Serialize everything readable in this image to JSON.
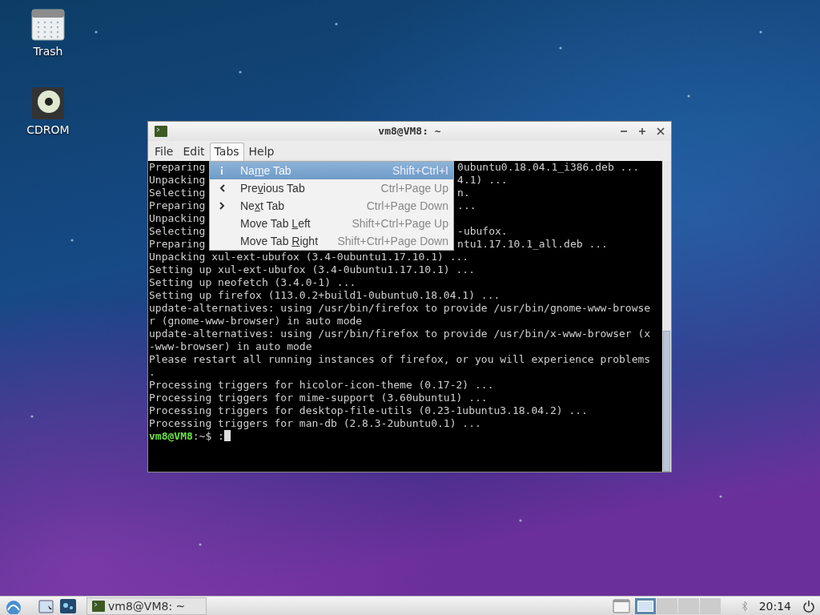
{
  "desktop_icons": [
    {
      "kind": "trash",
      "label": "Trash"
    },
    {
      "kind": "disc",
      "label": "CDROM"
    }
  ],
  "window": {
    "title": "vm8@VM8: ~",
    "menubar": [
      {
        "label": "File",
        "selected": false
      },
      {
        "label": "Edit",
        "selected": false
      },
      {
        "label": "Tabs",
        "selected": true
      },
      {
        "label": "Help",
        "selected": false
      }
    ],
    "tabs_menu": [
      {
        "kind": "info",
        "label_pre": "Na",
        "mnemonic": "m",
        "label_post": "e Tab",
        "shortcut": "Shift+Ctrl+I",
        "selected": true
      },
      {
        "kind": "prev",
        "label_pre": "Pre",
        "mnemonic": "v",
        "label_post": "ious Tab",
        "shortcut": "Ctrl+Page Up",
        "selected": false
      },
      {
        "kind": "next",
        "label_pre": "Ne",
        "mnemonic": "x",
        "label_post": "t Tab",
        "shortcut": "Ctrl+Page Down",
        "selected": false
      },
      {
        "kind": "plain",
        "label_pre": "Move Tab ",
        "mnemonic": "L",
        "label_post": "eft",
        "shortcut": "Shift+Ctrl+Page Up",
        "selected": false
      },
      {
        "kind": "plain",
        "label_pre": "Move Tab ",
        "mnemonic": "R",
        "label_post": "ight",
        "shortcut": "Shift+Ctrl+Page Down",
        "selected": false
      }
    ],
    "terminal_lines": [
      {
        "text": "Preparing",
        "tail": "0ubuntu0.18.04.1_i386.deb ..."
      },
      {
        "text": "Unpacking",
        "tail": "4.1) ..."
      },
      {
        "text": "Selecting",
        "tail": "n."
      },
      {
        "text": "Preparing",
        "tail": "..."
      },
      {
        "text": "Unpacking"
      },
      {
        "text": "Selecting",
        "tail": "-ubufox."
      },
      {
        "text": "Preparing",
        "tail": "ntu1.17.10.1_all.deb ..."
      },
      {
        "text": "Unpacking xul-ext-ubufox (3.4-0ubuntu1.17.10.1) ..."
      },
      {
        "text": "Setting up xul-ext-ubufox (3.4-0ubuntu1.17.10.1) ..."
      },
      {
        "text": "Setting up neofetch (3.4.0-1) ..."
      },
      {
        "text": "Setting up firefox (113.0.2+build1-0ubuntu0.18.04.1) ..."
      },
      {
        "text": "update-alternatives: using /usr/bin/firefox to provide /usr/bin/gnome-www-browse"
      },
      {
        "text": "r (gnome-www-browser) in auto mode"
      },
      {
        "text": "update-alternatives: using /usr/bin/firefox to provide /usr/bin/x-www-browser (x"
      },
      {
        "text": "-www-browser) in auto mode"
      },
      {
        "text": "Please restart all running instances of firefox, or you will experience problems"
      },
      {
        "text": "."
      },
      {
        "text": "Processing triggers for hicolor-icon-theme (0.17-2) ..."
      },
      {
        "text": "Processing triggers for mime-support (3.60ubuntu1) ..."
      },
      {
        "text": "Processing triggers for desktop-file-utils (0.23-1ubuntu3.18.04.2) ..."
      },
      {
        "text": "Processing triggers for man-db (2.8.3-2ubuntu0.1) ..."
      }
    ],
    "prompt": {
      "user": "vm8@VM8",
      "rest": ":~$ :"
    }
  },
  "taskbar": {
    "task": {
      "label": "vm8@VM8: ~"
    },
    "workspaces": [
      {
        "selected": true
      },
      {
        "selected": false
      },
      {
        "selected": false
      },
      {
        "selected": false
      }
    ],
    "clock": "20:14"
  }
}
